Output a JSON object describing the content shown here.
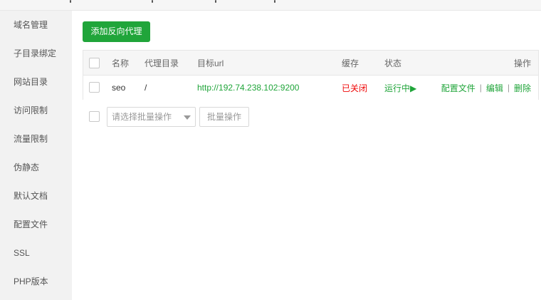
{
  "sidebar": {
    "items": [
      {
        "label": "域名管理"
      },
      {
        "label": "子目录绑定"
      },
      {
        "label": "网站目录"
      },
      {
        "label": "访问限制"
      },
      {
        "label": "流量限制"
      },
      {
        "label": "伪静态"
      },
      {
        "label": "默认文档"
      },
      {
        "label": "配置文件"
      },
      {
        "label": "SSL"
      },
      {
        "label": "PHP版本"
      }
    ]
  },
  "toolbar": {
    "add_label": "添加反向代理"
  },
  "table": {
    "headers": {
      "name": "名称",
      "proxy_dir": "代理目录",
      "target_url": "目标url",
      "cache": "缓存",
      "status": "状态",
      "actions": "操作"
    },
    "rows": [
      {
        "name": "seo",
        "proxy_dir": "/",
        "target_url": "http://192.74.238.102:9200",
        "cache": "已关闭",
        "status": "运行中▶",
        "action_config": "配置文件",
        "action_edit": "编辑",
        "action_delete": "删除",
        "separator": "|"
      }
    ]
  },
  "batch": {
    "select_placeholder": "请选择批量操作",
    "button_label": "批量操作"
  },
  "colors": {
    "accent": "#20a53a",
    "danger": "#ef0808"
  }
}
